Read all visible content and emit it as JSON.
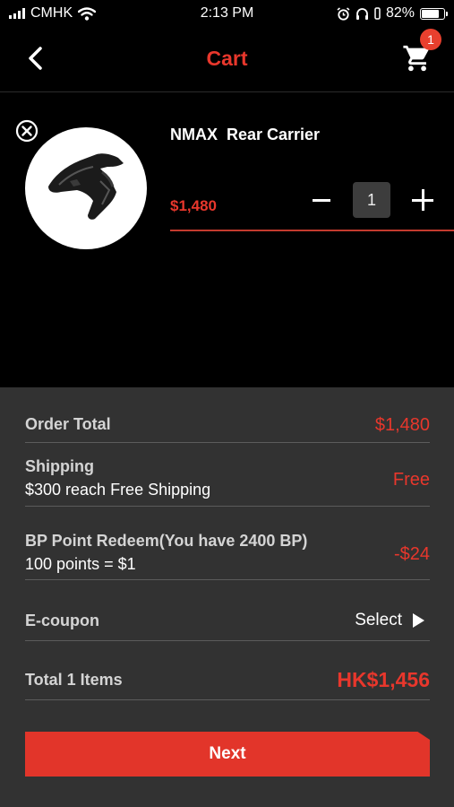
{
  "status_bar": {
    "carrier": "CMHK",
    "time": "2:13 PM",
    "battery": "82%",
    "battery_level": 0.82
  },
  "header": {
    "title": "Cart",
    "cart_badge": "1"
  },
  "item": {
    "name": "NMAX  Rear Carrier",
    "price": "$1,480",
    "quantity": "1"
  },
  "summary": {
    "order_total_label": "Order Total",
    "order_total_value": "$1,480",
    "shipping_label": "Shipping",
    "shipping_note": "$300 reach Free Shipping",
    "shipping_value": "Free",
    "bp_label": "BP Point Redeem(You have 2400 BP)",
    "bp_note": "100 points = $1",
    "bp_value": "-$24",
    "coupon_label": "E-coupon",
    "coupon_action": "Select",
    "total_label": "Total 1 Items",
    "total_value": "HK$1,456"
  },
  "next_label": "Next",
  "colors": {
    "accent": "#e8372c",
    "background": "#000000",
    "panel": "#323232"
  }
}
